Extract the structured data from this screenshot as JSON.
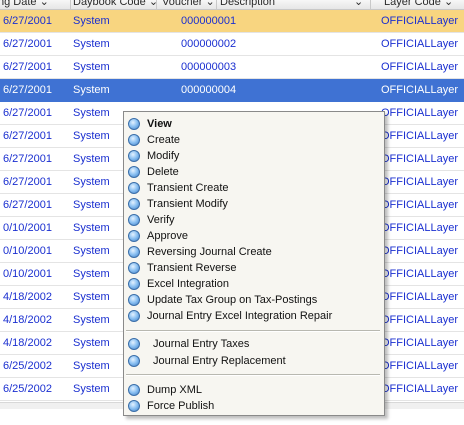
{
  "grid": {
    "columns": [
      {
        "label": "ng Date"
      },
      {
        "label": "Daybook Code"
      },
      {
        "label": "Voucher"
      },
      {
        "label": "Description"
      },
      {
        "label": "Layer Code"
      }
    ],
    "rows": [
      {
        "date": "6/27/2001",
        "daybook": "System",
        "voucher": "000000001",
        "layer": "OFFICIALLayer"
      },
      {
        "date": "6/27/2001",
        "daybook": "System",
        "voucher": "000000002",
        "layer": "OFFICIALLayer"
      },
      {
        "date": "6/27/2001",
        "daybook": "System",
        "voucher": "000000003",
        "layer": "OFFICIALLayer"
      },
      {
        "date": "6/27/2001",
        "daybook": "System",
        "voucher": "000000004",
        "layer": "OFFICIALLayer"
      },
      {
        "date": "6/27/2001",
        "daybook": "System",
        "voucher": "",
        "layer": "OFFICIALLayer"
      },
      {
        "date": "6/27/2001",
        "daybook": "System",
        "voucher": "",
        "layer": "OFFICIALLayer"
      },
      {
        "date": "6/27/2001",
        "daybook": "System",
        "voucher": "",
        "layer": "OFFICIALLayer"
      },
      {
        "date": "6/27/2001",
        "daybook": "System",
        "voucher": "",
        "layer": "OFFICIALLayer"
      },
      {
        "date": "6/27/2001",
        "daybook": "System",
        "voucher": "",
        "layer": "OFFICIALLayer"
      },
      {
        "date": "0/10/2001",
        "daybook": "System",
        "voucher": "",
        "layer": "OFFICIALLayer"
      },
      {
        "date": "0/10/2001",
        "daybook": "System",
        "voucher": "",
        "layer": "OFFICIALLayer"
      },
      {
        "date": "0/10/2001",
        "daybook": "System",
        "voucher": "",
        "layer": "OFFICIALLayer"
      },
      {
        "date": "4/18/2002",
        "daybook": "System",
        "voucher": "",
        "layer": "OFFICIALLayer"
      },
      {
        "date": "4/18/2002",
        "daybook": "System",
        "voucher": "",
        "layer": "OFFICIALLayer"
      },
      {
        "date": "4/18/2002",
        "daybook": "System",
        "voucher": "",
        "layer": "OFFICIALLayer"
      },
      {
        "date": "6/25/2002",
        "daybook": "System",
        "voucher": "",
        "layer": "OFFICIALLayer"
      },
      {
        "date": "6/25/2002",
        "daybook": "System",
        "voucher": "",
        "layer": "OFFICIALLayer"
      }
    ],
    "highlight_row": 0,
    "selected_row": 3,
    "colors": {
      "row_text": "#1a2fd0",
      "highlight": "#f8d580",
      "selected": "#3f72d3"
    }
  },
  "context_menu": {
    "icon": "gear-sphere-icon",
    "items": [
      {
        "label": "View",
        "bold": true
      },
      {
        "label": "Create"
      },
      {
        "label": "Modify"
      },
      {
        "label": "Delete"
      },
      {
        "label": "Transient Create"
      },
      {
        "label": "Transient Modify"
      },
      {
        "label": "Verify"
      },
      {
        "label": "Approve"
      },
      {
        "label": "Reversing Journal Create"
      },
      {
        "label": "Transient Reverse"
      },
      {
        "label": "Excel Integration"
      },
      {
        "label": "Update Tax Group on Tax-Postings"
      },
      {
        "label": "Journal Entry Excel Integration Repair"
      },
      {
        "label": "Journal Entry Taxes"
      },
      {
        "label": "Journal Entry Replacement"
      },
      {
        "label": "Dump XML"
      },
      {
        "label": "Force Publish"
      }
    ]
  }
}
